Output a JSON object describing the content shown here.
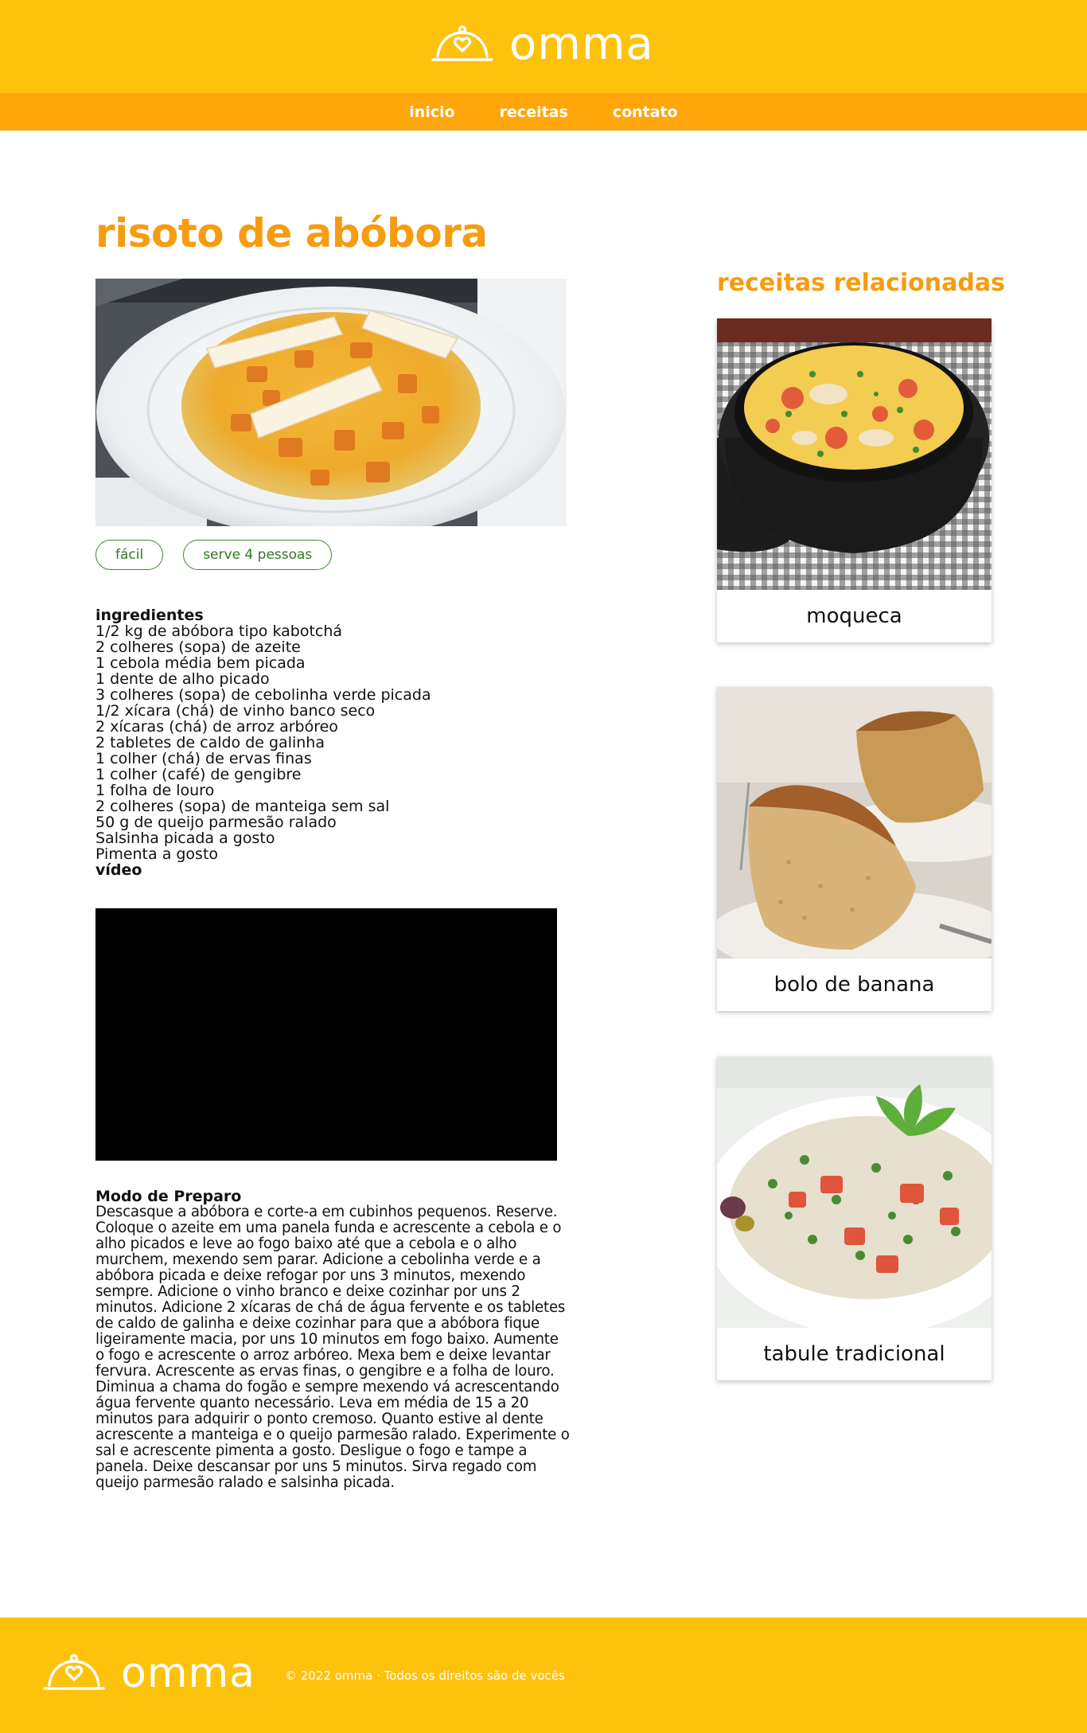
{
  "brand": {
    "name": "omma",
    "logo_icon": "cloche-heart-icon"
  },
  "nav": {
    "items": [
      "inicio",
      "receitas",
      "contato"
    ]
  },
  "recipe": {
    "title": "risoto de abóbora",
    "tags": [
      "fácil",
      "serve 4 pessoas"
    ],
    "ingredients_heading": "ingredientes",
    "ingredients": [
      "1/2 kg de abóbora tipo kabotchá",
      "2 colheres (sopa) de azeite",
      "1 cebola média bem picada",
      "1 dente de alho picado",
      "3 colheres (sopa) de cebolinha verde picada",
      "1/2 xícara (chá) de vinho banco seco",
      "2 xícaras (chá) de arroz arbóreo",
      "2 tabletes de caldo de galinha",
      "1 colher (chá) de ervas finas",
      "1 colher (café) de gengibre",
      "1 folha de louro",
      "2 colheres (sopa) de manteiga sem sal",
      "50 g de queijo parmesão ralado",
      "Salsinha picada a gosto",
      "Pimenta a gosto"
    ],
    "video_heading": "vídeo",
    "prep_heading": "Modo de Preparo",
    "prep_text": "Descasque a abóbora e corte-a em cubinhos pequenos. Reserve. Coloque o azeite em uma panela funda e acrescente a cebola e o alho picados e leve ao fogo baixo até que a cebola e o alho murchem, mexendo sem parar. Adicione a cebolinha verde e a abóbora picada e deixe refogar por uns 3 minutos, mexendo sempre. Adicione o vinho branco e deixe cozinhar por uns 2 minutos. Adicione 2 xícaras de chá de água fervente e os tabletes de caldo de galinha e deixe cozinhar para que a abóbora fique ligeiramente macia, por uns 10 minutos em fogo baixo. Aumente o fogo e acrescente o arroz arbóreo. Mexa bem e deixe levantar fervura. Acrescente as ervas finas, o gengibre e a folha de louro. Diminua a chama do fogão e sempre mexendo vá acrescentando água fervente quanto necessário. Leva em média de 15 a 20 minutos para adquirir o ponto cremoso. Quanto estive al dente acrescente a manteiga e o queijo parmesão ralado. Experimente o sal e acrescente pimenta a gosto. Desligue o fogo e tampe a panela. Deixe descansar por uns 5 minutos. Sirva regado com queijo parmesão ralado e salsinha picada."
  },
  "related": {
    "title": "receitas relacionadas",
    "items": [
      {
        "name": "moqueca"
      },
      {
        "name": "bolo de banana"
      },
      {
        "name": "tabule tradicional"
      }
    ]
  },
  "footer": {
    "copyright": "© 2022 omma · Todos os direitos são de vocês"
  },
  "colors": {
    "header": "#fdc20c",
    "nav": "#fea60a",
    "accent": "#f69c10",
    "tag": "#3c8a2e"
  }
}
